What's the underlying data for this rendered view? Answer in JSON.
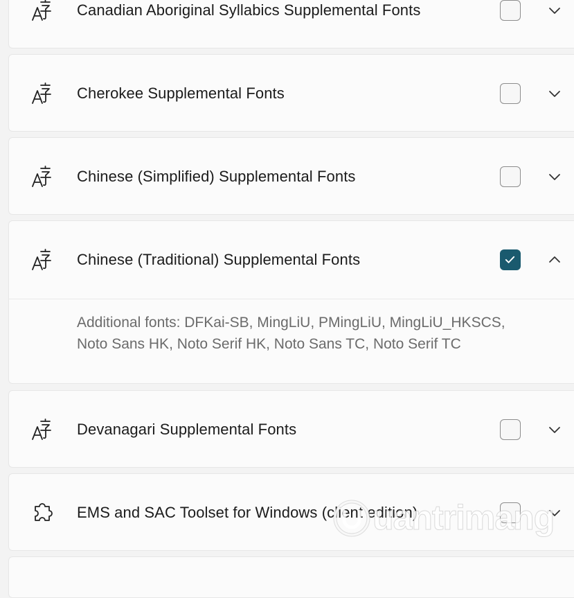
{
  "features": [
    {
      "label": "Canadian Aboriginal Syllabics Supplemental Fonts",
      "icon": "font-language-icon",
      "checked": false,
      "expanded": false
    },
    {
      "label": "Cherokee Supplemental Fonts",
      "icon": "font-language-icon",
      "checked": false,
      "expanded": false
    },
    {
      "label": "Chinese (Simplified) Supplemental Fonts",
      "icon": "font-language-icon",
      "checked": false,
      "expanded": false
    },
    {
      "label": "Chinese (Traditional) Supplemental Fonts",
      "icon": "font-language-icon",
      "checked": true,
      "expanded": true,
      "details": "Additional fonts: DFKai-SB, MingLiU, PMingLiU, MingLiU_HKSCS, Noto Sans HK, Noto Serif HK, Noto Sans TC, Noto Serif TC"
    },
    {
      "label": "Devanagari Supplemental Fonts",
      "icon": "font-language-icon",
      "checked": false,
      "expanded": false
    },
    {
      "label": "EMS and SAC Toolset for Windows (client edition)",
      "icon": "puzzle-piece-icon",
      "checked": false,
      "expanded": false
    }
  ],
  "watermark": {
    "text": "uantrimang",
    "icon": "watermark-logo-icon"
  },
  "colors": {
    "accent": "#1a5a6e",
    "card_bg": "#fbfbfb",
    "page_bg": "#f3f3f3",
    "detail_text": "#6b6b6b"
  }
}
